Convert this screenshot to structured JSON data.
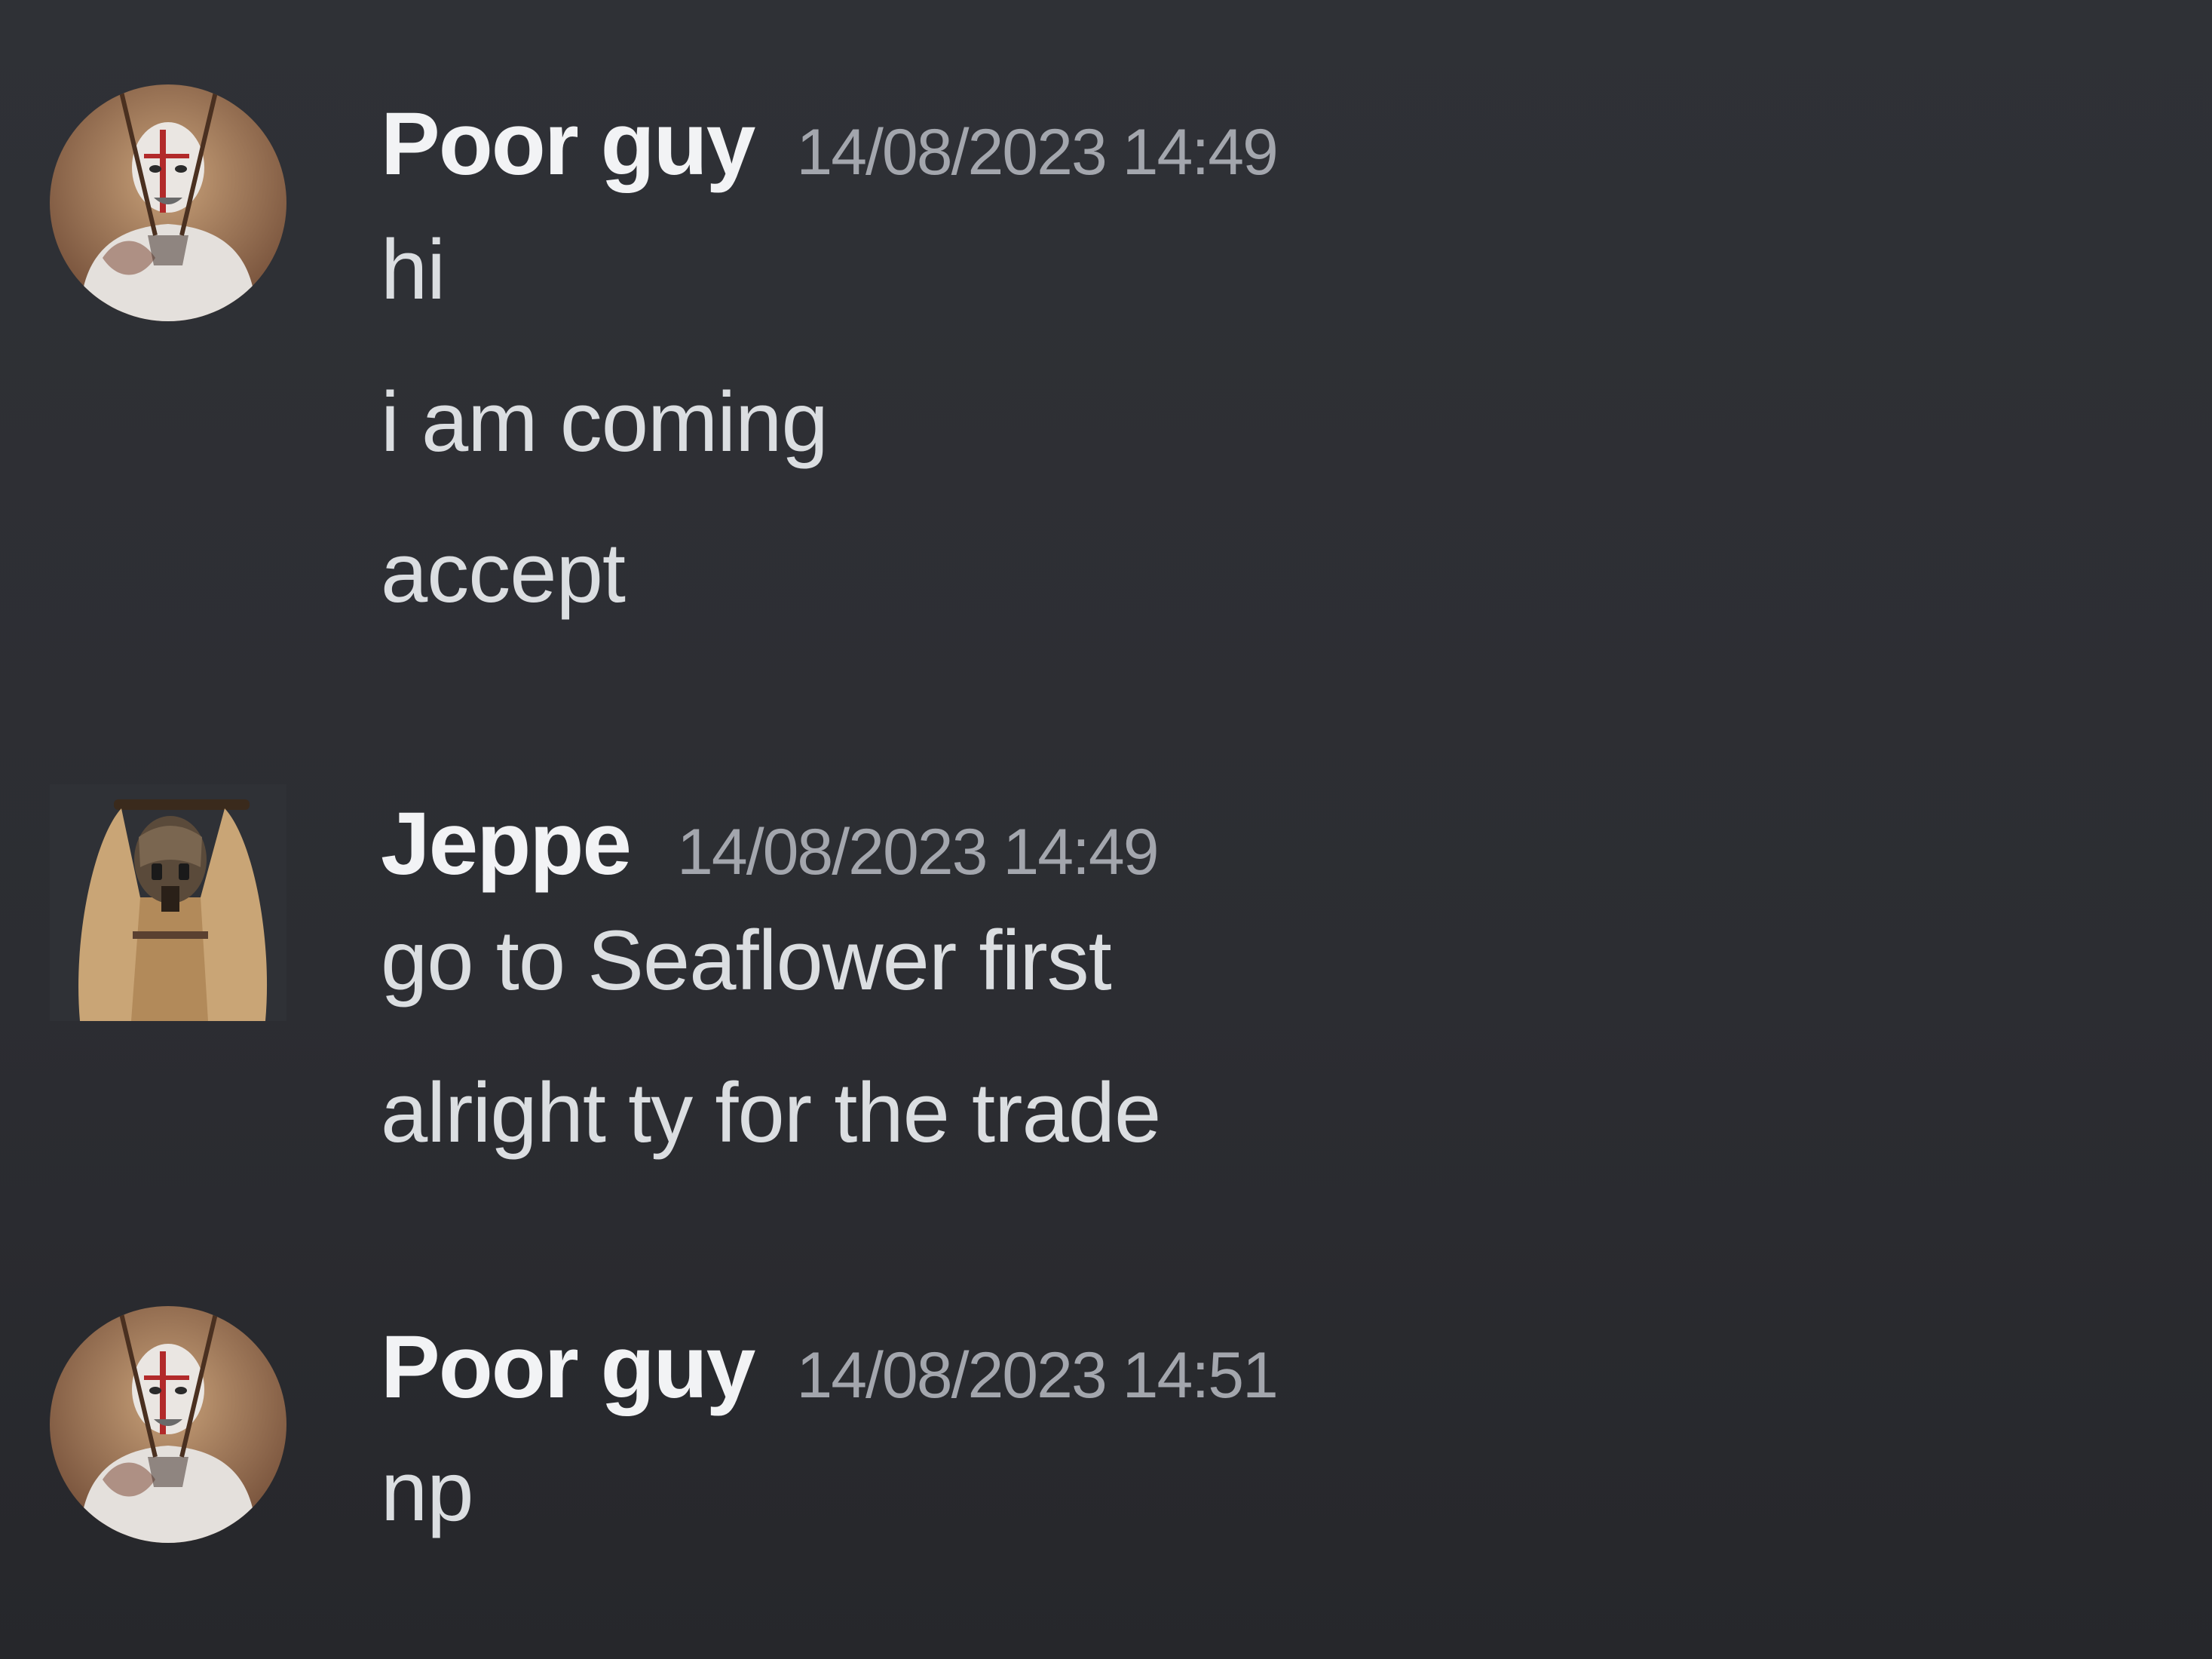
{
  "messages": [
    {
      "author": "Poor guy",
      "timestamp": "14/08/2023 14:49",
      "avatar": "warrior-avatar",
      "lines": [
        "hi",
        "i am coming",
        "accept"
      ]
    },
    {
      "author": "Jeppe",
      "timestamp": "14/08/2023 14:49",
      "avatar": "raider-avatar",
      "lines": [
        "go to Seaflower first",
        "alright ty for the trade"
      ]
    },
    {
      "author": "Poor guy",
      "timestamp": "14/08/2023 14:51",
      "avatar": "warrior-avatar",
      "lines": [
        "np"
      ]
    }
  ],
  "colors": {
    "background": "#313338",
    "username": "#f2f3f5",
    "timestamp": "#a3a6ad",
    "message_text": "#dbdee1"
  }
}
